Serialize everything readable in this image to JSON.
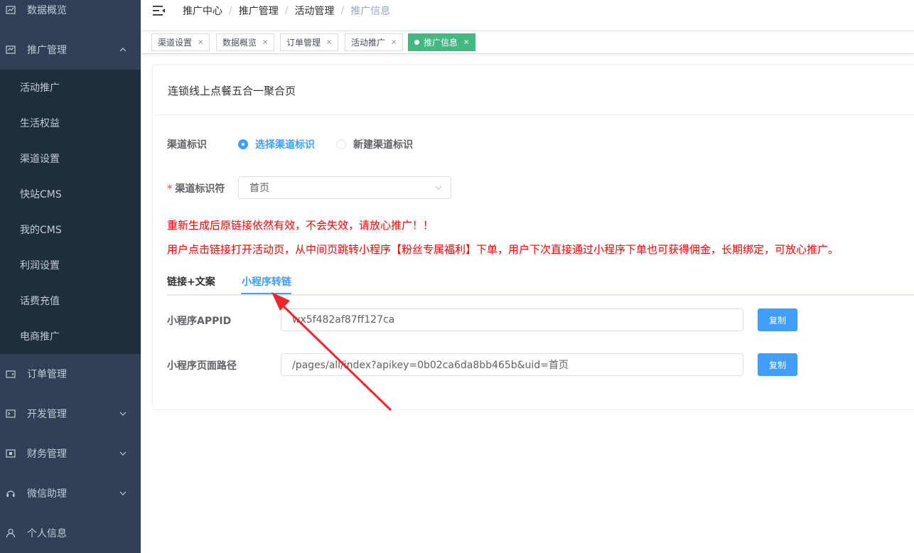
{
  "sidebar": {
    "top_items": [
      {
        "label": "数据概览",
        "icon": "chart-icon"
      },
      {
        "label": "推广管理",
        "icon": "trend-icon"
      }
    ],
    "sub_items": [
      "活动推广",
      "生活权益",
      "渠道设置",
      "快站CMS",
      "我的CMS",
      "利润设置",
      "话费充值",
      "电商推广"
    ],
    "bottom_items": [
      {
        "label": "订单管理",
        "icon": "wallet-icon"
      },
      {
        "label": "开发管理",
        "icon": "terminal-icon"
      },
      {
        "label": "财务管理",
        "icon": "finance-icon"
      },
      {
        "label": "微信助理",
        "icon": "headset-icon"
      },
      {
        "label": "个人信息",
        "icon": "user-icon"
      }
    ]
  },
  "breadcrumb": [
    "推广中心",
    "推广管理",
    "活动管理",
    "推广信息"
  ],
  "tags": [
    "渠道设置",
    "数据概览",
    "订单管理",
    "活动推广",
    "推广信息"
  ],
  "card": {
    "title": "连锁线上点餐五合一聚合页",
    "channel_label": "渠道标识",
    "radio_select": "选择渠道标识",
    "radio_new": "新建渠道标识",
    "identifier_label": "渠道标识符",
    "identifier_value": "首页",
    "warning1": "重新生成后原链接依然有效，不会失效，请放心推广！！",
    "warning2": "用户点击链接打开活动页，从中间页跳转小程序【粉丝专属福利】下单，用户下次直接通过小程序下单也可获得佣金，长期绑定，可放心推广。",
    "tab_link": "链接+文案",
    "tab_mini": "小程序转链",
    "appid_label": "小程序APPID",
    "appid_value": "wx5f482af87ff127ca",
    "path_label": "小程序页面路径",
    "path_value": "/pages/all/index?apikey=0b02ca6da8bb465b&uid=首页",
    "copy_label": "复制"
  },
  "colors": {
    "sidebar_bg": "#304156",
    "submenu_bg": "#1f2d3d",
    "primary": "#409eff",
    "tag_active": "#42b983",
    "warning": "#ff0000",
    "annotation_arrow": "#f0262f"
  }
}
